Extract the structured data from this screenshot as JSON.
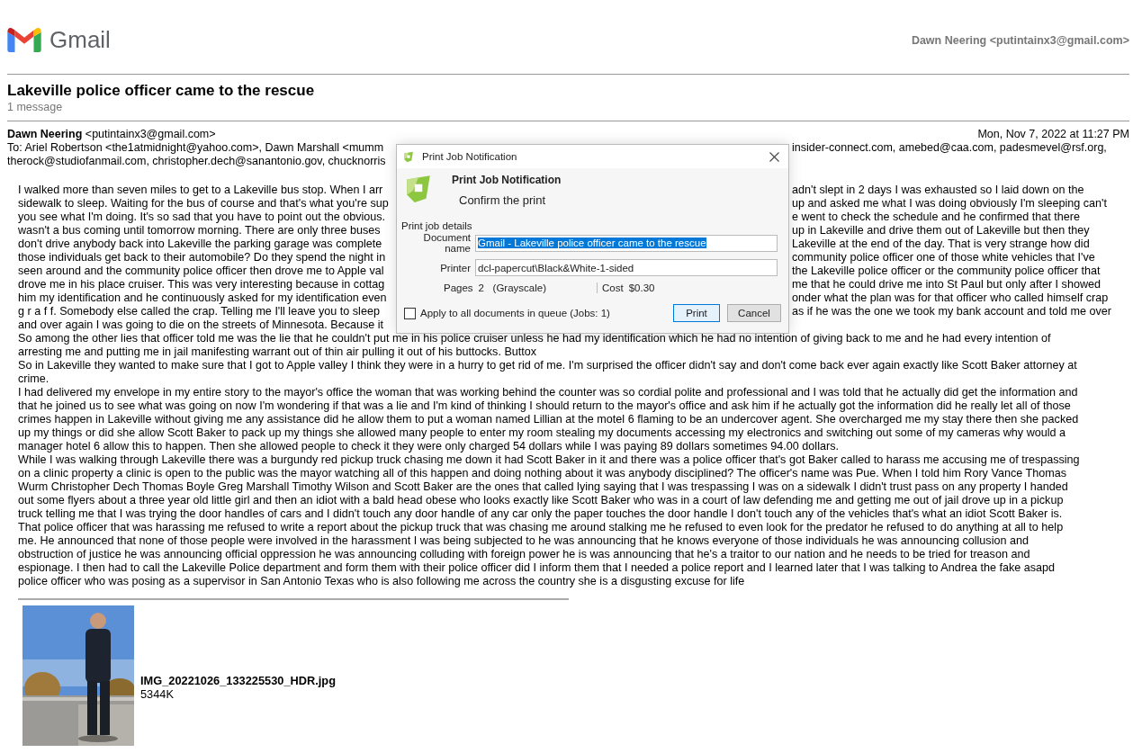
{
  "header": {
    "logo_text": "Gmail",
    "account": "Dawn Neering <putintainx3@gmail.com>"
  },
  "thread": {
    "subject": "Lakeville police officer came to the rescue",
    "count": "1 message"
  },
  "message": {
    "from": "**Dawn Neering** <putintainx3@gmail.com>",
    "date": "Mon, Nov 7, 2022 at 11:27 PM",
    "to": [
      {
        "text": "To: Ariel Robertson <the1atmidnight@yahoo.com>, Dawn Marshall <mumm",
        "text_right": "insider-connect.com, amebed@caa.com, padesmevel@rsf.org,"
      },
      {
        "text": "therock@studiofanmail.com, christopher.dech@sanantonio.gov, chucknorris"
      }
    ],
    "lines": [
      {
        "text": "I walked more than seven miles to get to a Lakeville bus stop. When I arr",
        "text_right": "adn't slept in 2 days I was exhausted so I laid down on the"
      },
      {
        "text": "sidewalk to sleep. Waiting for the bus of course and that's what you're sup",
        "text_right": "up and asked me what I was doing obviously I'm sleeping can't"
      },
      {
        "text": "you see what I'm doing. It's so sad that you have to point out the obvious.",
        "text_right": "e went to check the schedule and he confirmed that there"
      },
      {
        "text": "wasn't a bus coming until tomorrow morning. There are only three buses",
        "text_right": "up in Lakeville and drive them out of Lakeville but then they"
      },
      {
        "text": "don't drive anybody back into Lakeville the parking garage was complete",
        "text_right": "Lakeville at the end of the day. That is very strange how did"
      },
      {
        "text": "those individuals get back to their automobile? Do they spend the night in",
        "text_right": "community police officer one of those white vehicles that I've"
      },
      {
        "text": "seen around and the community police officer then drove me to Apple val",
        "text_right": "the Lakeville police officer or the community police officer that"
      },
      {
        "text": "drove me in his place cruiser. This was very interesting because in cottag",
        "text_right": "me that he could drive me into St Paul but only after I showed"
      },
      {
        "text": "him my identification and he continuously asked for my identification even",
        "text_right": "onder what the plan was for that officer who called himself crap"
      },
      {
        "text": "g r a f f. Somebody else called the crap. Telling me I'll leave you to sleep",
        "text_right": "as if he was the one we took my bank account and told me over"
      },
      {
        "text": "and over again I was going to die on the streets of Minnesota. Because it"
      },
      {
        "text": "So among the other lies that officer told me was the lie that he couldn't put me in his police cruiser unless he had my identification which he had no intention of giving back to me and he had every intention of"
      },
      {
        "text": "arresting me and putting me in jail manifesting warrant out of thin air pulling it out of his buttocks. Buttox"
      },
      {
        "text": "So in Lakeville they wanted to make sure that I got to Apple valley I think they were in a hurry to get rid of me. I'm surprised the officer didn't say and don't come back ever again exactly like Scott Baker attorney at"
      },
      {
        "text": "crime."
      },
      {
        "text": "I had delivered my envelope in my entire story to the mayor's office the woman that was working behind the counter was so cordial polite and professional and I was told that he actually did get the information and"
      },
      {
        "text": "that he joined us to see what was going on now I'm wondering if that was a lie and I'm kind of thinking I should return to the mayor's office and ask him if he actually got the information did he really let all of those"
      },
      {
        "text": "crimes happen in Lakeville without giving me any assistance did he allow them to put a woman named Lillian at the motel 6 flaming to be an undercover agent. She overcharged me my stay there then she packed"
      },
      {
        "text": "up my things or did she allow Scott Baker to pack up my things she allowed many people to enter my room stealing my documents accessing my electronics and switching out some of my cameras why would a"
      },
      {
        "text": "manager hotel 6 allow this to happen. Then she allowed people to check it they were only charged 54 dollars while I was paying 89 dollars sometimes 94.00 dollars."
      },
      {
        "text": "While I was walking through Lakeville there was a burgundy red pickup truck chasing me down it had Scott Baker in it and there was a police officer that's got Baker called to harass me accusing me of trespassing"
      },
      {
        "text": "on a clinic property a clinic is open to the public was the mayor watching all of this happen and doing nothing about it was anybody disciplined? The officer's name was Pue. When I told him Rory Vance Thomas"
      },
      {
        "text": "Wurm Christopher Dech Thomas Boyle Greg Marshall Timothy Wilson and Scott Baker are the ones that called lying saying that I was trespassing I was on a sidewalk I didn't trust pass on any property I handed"
      },
      {
        "text": "out some flyers about a three year old little girl and then an idiot with a bald head obese who looks exactly like Scott Baker who was in a court of law defending me and getting me out of jail drove up in a pickup"
      },
      {
        "text": "truck telling me that I was trying the door handles of cars and I didn't touch any door handle of any car only the paper touches the door handle I don't touch any of the vehicles that's what an idiot Scott Baker is."
      },
      {
        "text": "That police officer that was harassing me refused to write a report about the pickup truck that was chasing me around stalking me he refused to even look for the predator he refused to do anything at all to help"
      },
      {
        "text": "me. He announced that none of those people were involved in the harassment I was being subjected to he was announcing that he knows everyone of those individuals he was announcing collusion and"
      },
      {
        "text": "obstruction of justice he was announcing official oppression he was announcing colluding with foreign power he is was announcing that he's a traitor to our nation and he needs to be tried for treason and"
      },
      {
        "text": "espionage. I then had to call the Lakeville Police department and form them with their police officer did I inform them that I needed a police report and I learned later that I was talking to Andrea the fake asapd"
      },
      {
        "text": "police officer who was posing as a supervisor in San Antonio Texas who is also following me across the country she is a disgusting excuse for life"
      }
    ],
    "attachment": {
      "kind": "picture",
      "filename": "IMG_20221026_133225530_HDR.jpg",
      "size": "5344K"
    }
  },
  "dialog": {
    "title": "Print Job Notification",
    "heading": "Print Job Notification",
    "subheading": "Confirm the print",
    "group_label": "Print job details",
    "fields": [
      {
        "label": "Document name",
        "value": "Gmail - Lakeville police officer came to the rescue",
        "highlighted": true
      },
      {
        "label": "Printer",
        "value": "dcl-papercut\\Black&White-1-sided",
        "highlighted": false
      }
    ],
    "pages_label": "Pages",
    "pages": "2   (Grayscale)",
    "cost_label": "Cost",
    "cost": "$0.30",
    "apply_all": {
      "label": "Apply to all documents in queue (Jobs: 1)",
      "checked": false
    },
    "buttons": [
      {
        "label": "Print",
        "default": true
      },
      {
        "label": "Cancel",
        "default": false
      }
    ]
  }
}
